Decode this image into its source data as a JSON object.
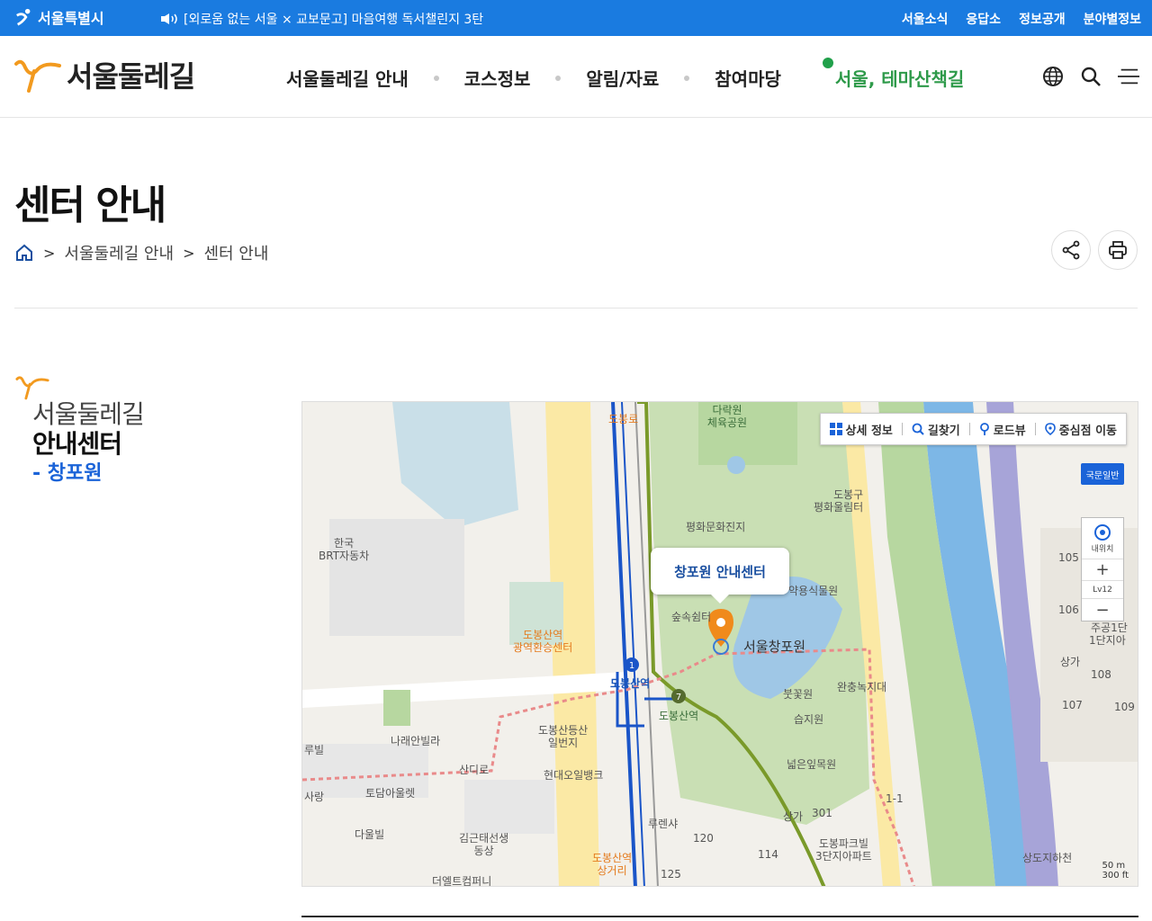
{
  "topbar": {
    "logo_text": "서울특별시",
    "notice": "[외로움 없는 서울 × 교보문고] 마음여행 독서챌린지 3탄",
    "links": [
      "서울소식",
      "응답소",
      "정보공개",
      "분야별정보"
    ]
  },
  "header": {
    "brand": "서울둘레길",
    "menu": [
      "서울둘레길 안내",
      "코스정보",
      "알림/자료",
      "참여마당"
    ],
    "active_menu": "서울, 테마산책길"
  },
  "page": {
    "title": "센터 안내",
    "breadcrumb": [
      "서울둘레길 안내",
      "센터 안내"
    ]
  },
  "section": {
    "line1": "서울둘레길",
    "line2": "안내센터",
    "line3": "- 창포원"
  },
  "map": {
    "toolbar": [
      "상세 정보",
      "길찾기",
      "로드뷰",
      "중심점 이동"
    ],
    "map_type": "국문일반",
    "my_location": "내위치",
    "zoom_level": "Lv12",
    "popup": "창포원 안내센터",
    "scale_m": "50 m",
    "scale_ft": "300 ft",
    "labels": {
      "park1": "다락원\n체육공원",
      "peace": "평화문화진지",
      "dobong_gu": "도봉구\n평화울림터",
      "brt": "한국\nBRT자동차",
      "transfer": "도봉산역\n광역환승센터",
      "yak": "약용식물원",
      "forest": "숲속쉼터",
      "changpo": "서울창포원",
      "buffer": "완충녹지대",
      "bukkot": "붓꽃원",
      "wetland": "습지원",
      "leaf": "넓은잎목원",
      "station1": "도봉산역",
      "station7": "도봉산역",
      "shop": "도봉산등산\n일번지",
      "hd": "현대오일뱅크",
      "narae": "나래안빌라",
      "toeul": "토담아울렛",
      "daeul": "다울빌",
      "sandeul": "산디로",
      "gimgeun": "김근태선생\n동상",
      "deelt": "더엘트컴퍼니",
      "dobong_st": "도봉산역\n상거리",
      "rouen": "루렌샤",
      "apt": "도봉파크빌\n3단지아파트",
      "sangga1": "상가",
      "sangga2": "상가",
      "n120": "120",
      "n114": "114",
      "n125": "125",
      "n301": "301",
      "n105": "105",
      "n106": "106",
      "n107": "107",
      "n108": "108",
      "n109": "109",
      "danji": "1단지아",
      "juan": "주공1단",
      "n11": "1-1",
      "sangdo": "상도지하천",
      "rubil": "루빌",
      "sa": "사랑",
      "dobongro": "도봉로"
    }
  },
  "colors": {
    "topbar": "#1a7be0",
    "active": "#2e9a4a",
    "accent_blue": "#1a63d8",
    "brand_orange": "#f29a1f"
  }
}
